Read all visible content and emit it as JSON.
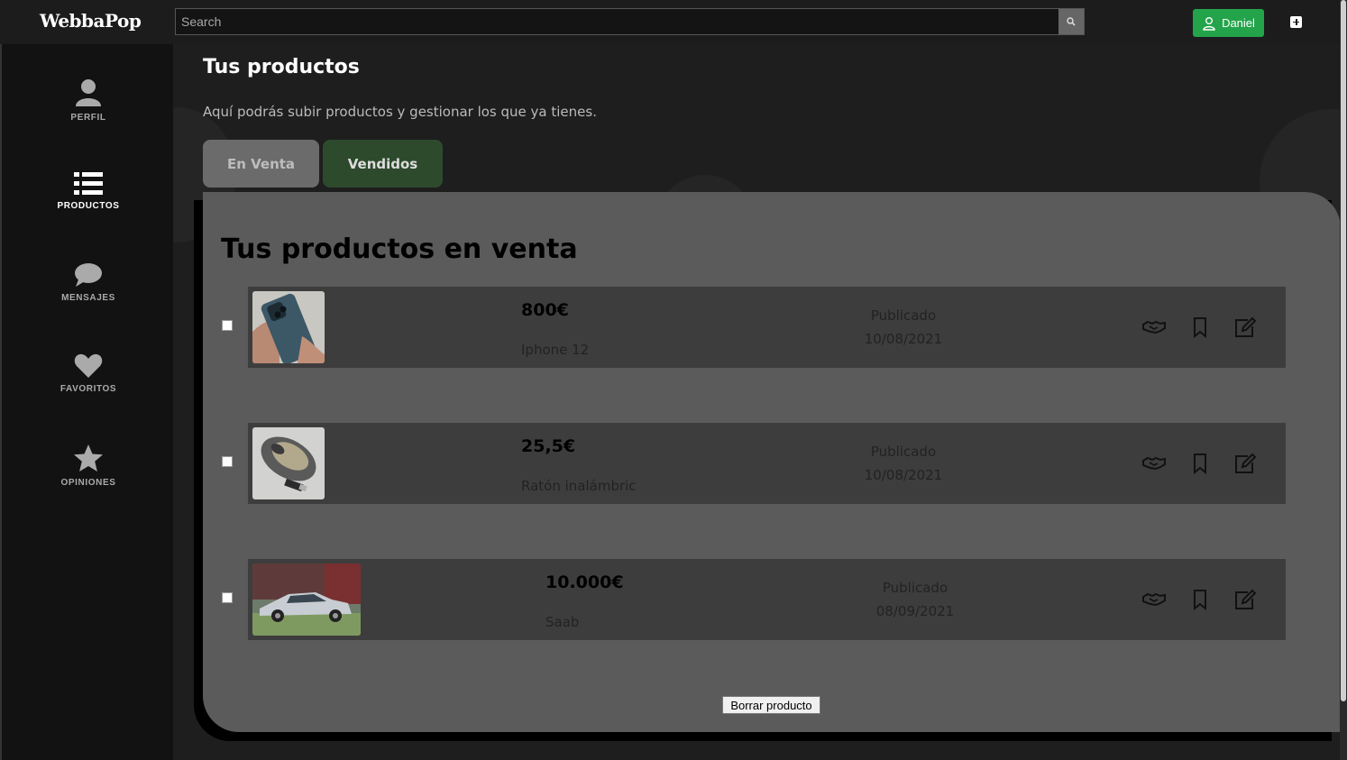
{
  "app": {
    "logo": "WebbaPop"
  },
  "search": {
    "placeholder": "Search"
  },
  "user": {
    "name": "Daniel"
  },
  "sidebar": {
    "items": [
      {
        "label": "PERFIL",
        "icon": "user-icon"
      },
      {
        "label": "PRODUCTOS",
        "icon": "list-icon",
        "active": true
      },
      {
        "label": "MENSAJES",
        "icon": "chat-bubble-icon"
      },
      {
        "label": "FAVORITOS",
        "icon": "heart-icon"
      },
      {
        "label": "OPINIONES",
        "icon": "star-icon"
      }
    ]
  },
  "page": {
    "title": "Tus productos",
    "subtitle": "Aquí podrás subir productos y gestionar los que ya tienes.",
    "tabs": [
      {
        "label": "En Venta",
        "active": true
      },
      {
        "label": "Vendidos",
        "active": false
      }
    ],
    "panel_title": "Tus productos en venta",
    "delete_button": "Borrar producto"
  },
  "products": [
    {
      "price": "800€",
      "name": "Iphone 12",
      "status": "Publicado",
      "date": "10/08/2021",
      "image": "phone-photo"
    },
    {
      "price": "25,5€",
      "name": "Ratón inalámbric",
      "status": "Publicado",
      "date": "10/08/2021",
      "image": "mouse-photo"
    },
    {
      "price": "10.000€",
      "name": "Saab",
      "status": "Publicado",
      "date": "08/09/2021",
      "image": "car-photo"
    }
  ],
  "colors": {
    "accent_green": "#23a44a",
    "panel": "#5b5b5b",
    "row": "#3d3d3d",
    "sidebar": "#121212"
  }
}
